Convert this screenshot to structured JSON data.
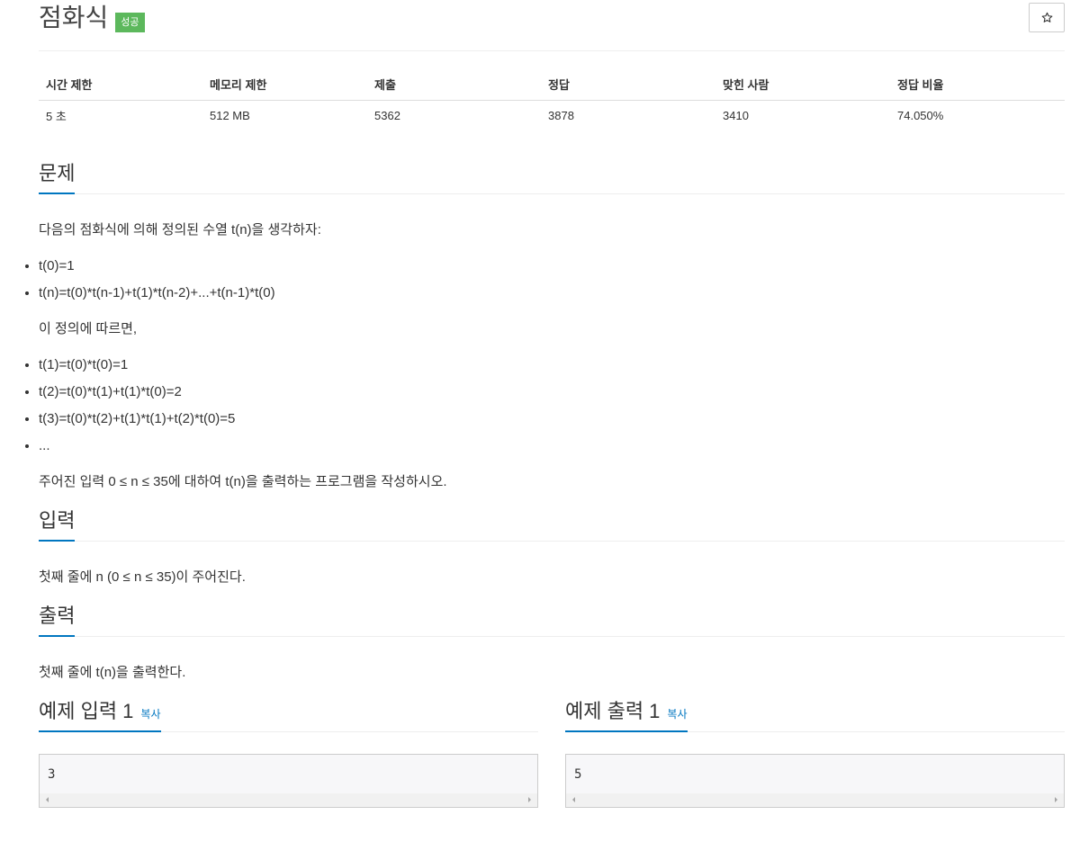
{
  "problem": {
    "title": "점화식",
    "status_badge": "성공",
    "star_icon": "star-icon"
  },
  "stats": {
    "headers": [
      "시간 제한",
      "메모리 제한",
      "제출",
      "정답",
      "맞힌 사람",
      "정답 비율"
    ],
    "values": [
      "5 초",
      "512 MB",
      "5362",
      "3878",
      "3410",
      "74.050%"
    ]
  },
  "sections": {
    "description": {
      "heading": "문제",
      "intro": "다음의 점화식에 의해 정의된 수열 t(n)을 생각하자:",
      "definition": [
        "t(0)=1",
        "t(n)=t(0)*t(n-1)+t(1)*t(n-2)+...+t(n-1)*t(0)"
      ],
      "transition": "이 정의에 따르면,",
      "examples": [
        "t(1)=t(0)*t(0)=1",
        "t(2)=t(0)*t(1)+t(1)*t(0)=2",
        "t(3)=t(0)*t(2)+t(1)*t(1)+t(2)*t(0)=5",
        "..."
      ],
      "task": "주어진 입력 0 ≤ n ≤ 35에 대하여 t(n)을 출력하는 프로그램을 작성하시오."
    },
    "input": {
      "heading": "입력",
      "text": "첫째 줄에 n (0 ≤ n ≤ 35)이 주어진다."
    },
    "output": {
      "heading": "출력",
      "text": "첫째 줄에 t(n)을 출력한다."
    }
  },
  "samples": [
    {
      "heading": "예제 입력 1",
      "copy_label": "복사",
      "content": "3"
    },
    {
      "heading": "예제 출력 1",
      "copy_label": "복사",
      "content": "5"
    }
  ],
  "icons": {
    "scroll_left": "scroll-left-arrow-icon",
    "scroll_right": "scroll-right-arrow-icon"
  },
  "colors": {
    "accent": "#0076c0",
    "success": "#5cb85c",
    "text": "#333333"
  }
}
